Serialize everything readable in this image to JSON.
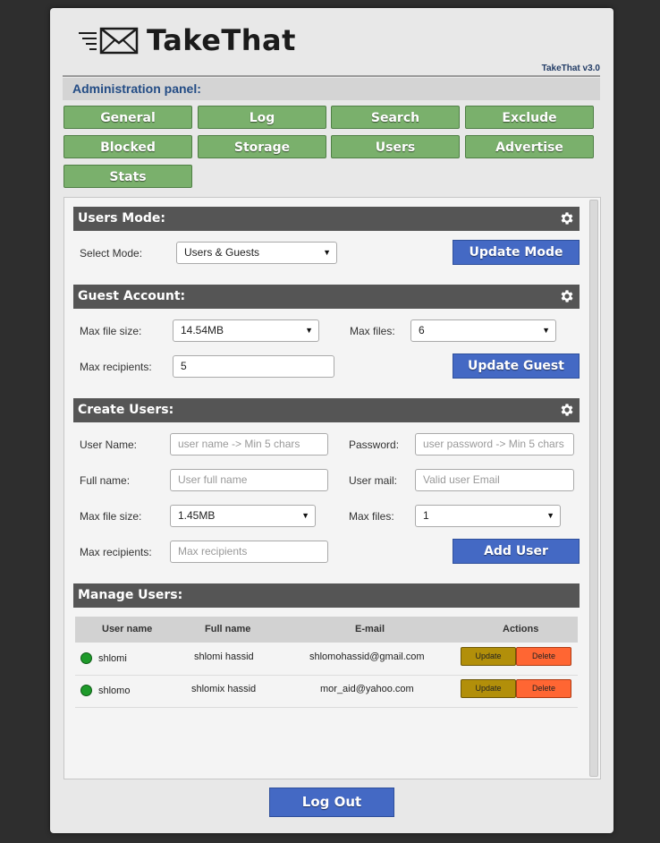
{
  "app": {
    "title": "TakeThat",
    "version": "TakeThat v3.0"
  },
  "admin_panel_label": "Administration panel:",
  "nav": [
    "General",
    "Log",
    "Search",
    "Exclude",
    "Blocked",
    "Storage",
    "Users",
    "Advertise",
    "Stats"
  ],
  "users_mode": {
    "title": "Users Mode:",
    "select_label": "Select Mode:",
    "select_value": "Users & Guests",
    "button": "Update Mode"
  },
  "guest_account": {
    "title": "Guest Account:",
    "max_file_size_label": "Max file size:",
    "max_file_size_value": "14.54MB",
    "max_files_label": "Max files:",
    "max_files_value": "6",
    "max_recipients_label": "Max recipients:",
    "max_recipients_value": "5",
    "button": "Update Guest"
  },
  "create_users": {
    "title": "Create Users:",
    "username_label": "User Name:",
    "username_placeholder": "user name -> Min 5 chars",
    "password_label": "Password:",
    "password_placeholder": "user password -> Min 5 chars",
    "fullname_label": "Full name:",
    "fullname_placeholder": "User full name",
    "usermail_label": "User mail:",
    "usermail_placeholder": "Valid user Email",
    "max_file_size_label": "Max file size:",
    "max_file_size_value": "1.45MB",
    "max_files_label": "Max files:",
    "max_files_value": "1",
    "max_recipients_label": "Max recipients:",
    "max_recipients_placeholder": "Max recipients",
    "button": "Add User"
  },
  "manage_users": {
    "title": "Manage Users:",
    "columns": [
      "User name",
      "Full name",
      "E-mail",
      "Actions"
    ],
    "rows": [
      {
        "username": "shlomi",
        "fullname": "shlomi hassid",
        "email": "shlomohassid@gmail.com",
        "update": "Update",
        "delete": "Delete"
      },
      {
        "username": "shlomo",
        "fullname": "shlomix hassid",
        "email": "mor_aid@yahoo.com",
        "update": "Update",
        "delete": "Delete"
      }
    ]
  },
  "logout": "Log Out",
  "colors": {
    "nav_green": "#7ab06c",
    "button_blue": "#4469c4",
    "section_dark": "#555555",
    "status_online": "#1e9a2a",
    "update_btn": "#b28f0a",
    "delete_btn": "#ff6633"
  },
  "icons": {
    "logo": "mail-envelope-icon",
    "section": "gear-icon",
    "status": "online-dot-icon"
  }
}
